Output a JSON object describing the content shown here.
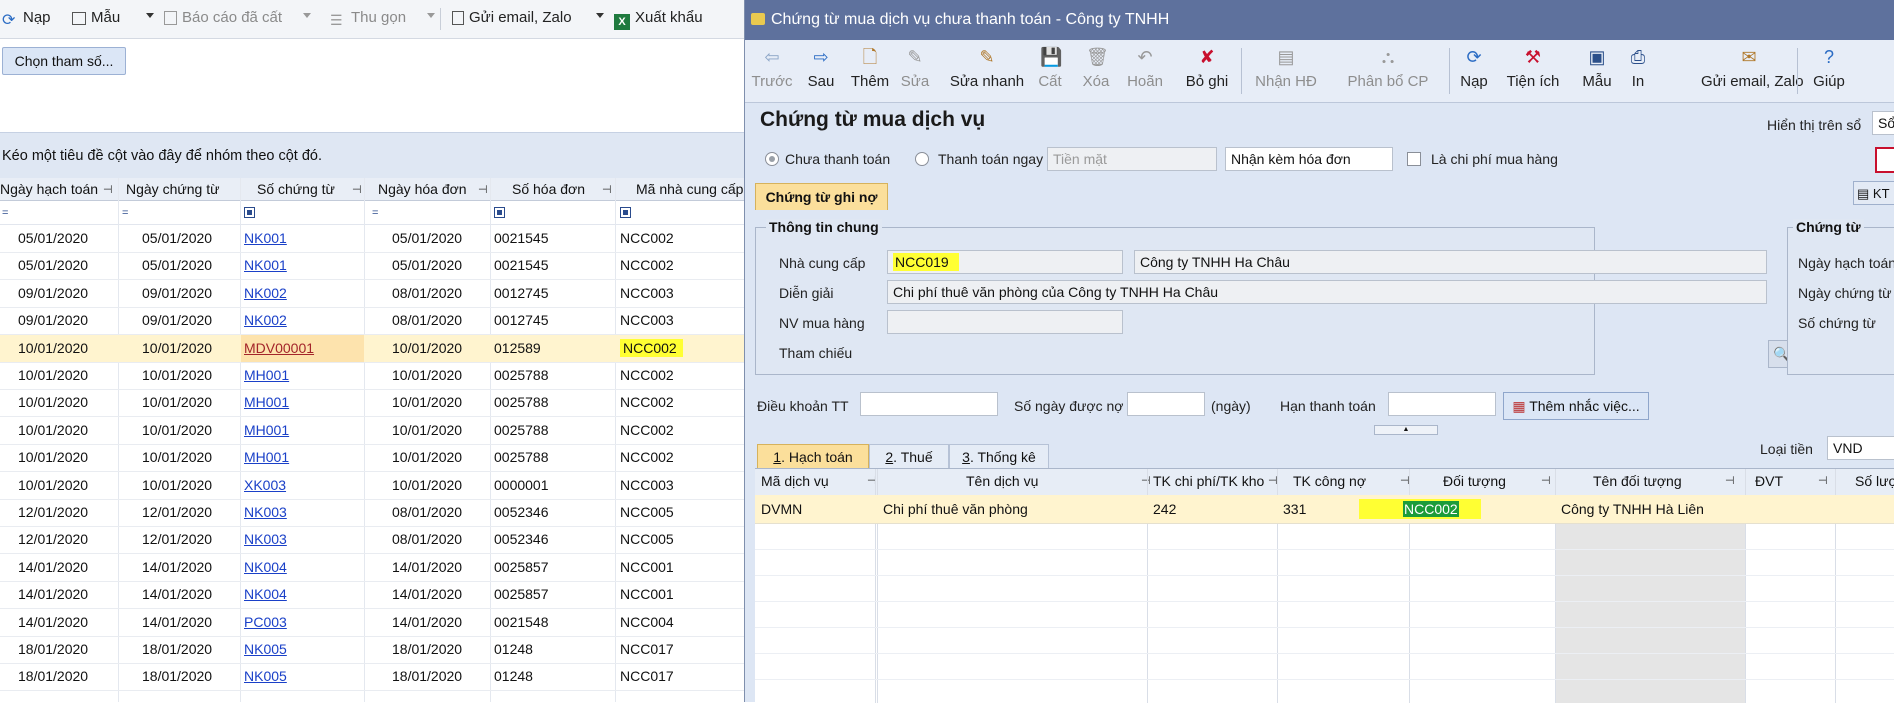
{
  "left_window": {
    "toolbar": [
      {
        "icon": "refresh-icon",
        "label": "Nạp",
        "disabled": false
      },
      {
        "icon": "template-icon",
        "label": "Mẫu",
        "disabled": false
      },
      {
        "icon": "report-icon",
        "label": "Báo cáo đã cất",
        "disabled": true
      },
      {
        "icon": "collapse-icon",
        "label": "Thu gọn",
        "disabled": true
      },
      {
        "icon": "email-icon",
        "label": "Gửi email, Zalo",
        "disabled": false
      },
      {
        "icon": "excel-icon",
        "label": "Xuất khẩu",
        "disabled": false
      }
    ],
    "choose_param_button": "Chọn tham số...",
    "group_hint": "Kéo một tiêu đề cột vào đây để nhóm theo cột đó.",
    "columns": [
      "Ngày hạch toán",
      "Ngày chứng từ",
      "Số chứng từ",
      "Ngày hóa đơn",
      "Số hóa đơn",
      "Mã nhà cung cấp"
    ],
    "rows": [
      [
        "05/01/2020",
        "05/01/2020",
        "NK001",
        "05/01/2020",
        "0021545",
        "NCC002"
      ],
      [
        "05/01/2020",
        "05/01/2020",
        "NK001",
        "05/01/2020",
        "0021545",
        "NCC002"
      ],
      [
        "09/01/2020",
        "09/01/2020",
        "NK002",
        "08/01/2020",
        "0012745",
        "NCC003"
      ],
      [
        "09/01/2020",
        "09/01/2020",
        "NK002",
        "08/01/2020",
        "0012745",
        "NCC003"
      ],
      [
        "10/01/2020",
        "10/01/2020",
        "MDV00001",
        "10/01/2020",
        "012589",
        "NCC002"
      ],
      [
        "10/01/2020",
        "10/01/2020",
        "MH001",
        "10/01/2020",
        "0025788",
        "NCC002"
      ],
      [
        "10/01/2020",
        "10/01/2020",
        "MH001",
        "10/01/2020",
        "0025788",
        "NCC002"
      ],
      [
        "10/01/2020",
        "10/01/2020",
        "MH001",
        "10/01/2020",
        "0025788",
        "NCC002"
      ],
      [
        "10/01/2020",
        "10/01/2020",
        "MH001",
        "10/01/2020",
        "0025788",
        "NCC002"
      ],
      [
        "10/01/2020",
        "10/01/2020",
        "XK003",
        "10/01/2020",
        "0000001",
        "NCC003"
      ],
      [
        "12/01/2020",
        "12/01/2020",
        "NK003",
        "08/01/2020",
        "0052346",
        "NCC005"
      ],
      [
        "12/01/2020",
        "12/01/2020",
        "NK003",
        "08/01/2020",
        "0052346",
        "NCC005"
      ],
      [
        "14/01/2020",
        "14/01/2020",
        "NK004",
        "14/01/2020",
        "0025857",
        "NCC001"
      ],
      [
        "14/01/2020",
        "14/01/2020",
        "NK004",
        "14/01/2020",
        "0025857",
        "NCC001"
      ],
      [
        "14/01/2020",
        "14/01/2020",
        "PC003",
        "14/01/2020",
        "0021548",
        "NCC004"
      ],
      [
        "18/01/2020",
        "18/01/2020",
        "NK005",
        "18/01/2020",
        "01248",
        "NCC017"
      ],
      [
        "18/01/2020",
        "18/01/2020",
        "NK005",
        "18/01/2020",
        "01248",
        "NCC017"
      ]
    ]
  },
  "dialog": {
    "title": "Chứng từ mua dịch vụ chưa thanh toán - Công ty TNHH",
    "toolbar": [
      {
        "label": "Trước",
        "glyph": "⇦",
        "disabled": true
      },
      {
        "label": "Sau",
        "glyph": "⇨",
        "disabled": false
      },
      {
        "label": "Thêm",
        "glyph": "🗋",
        "disabled": false
      },
      {
        "label": "Sửa",
        "glyph": "✎",
        "disabled": true
      },
      {
        "label": "Sửa nhanh",
        "glyph": "✎",
        "disabled": false
      },
      {
        "label": "Cất",
        "glyph": "💾",
        "disabled": true
      },
      {
        "label": "Xóa",
        "glyph": "🗑",
        "disabled": true
      },
      {
        "label": "Hoãn",
        "glyph": "↶",
        "disabled": true
      },
      {
        "label": "Bỏ ghi",
        "glyph": "✘",
        "disabled": false
      },
      {
        "label": "Nhận HĐ",
        "glyph": "▤",
        "disabled": true
      },
      {
        "label": "Phân bổ CP",
        "glyph": "⛬",
        "disabled": true
      },
      {
        "label": "Nạp",
        "glyph": "⟳",
        "disabled": false
      },
      {
        "label": "Tiện ích",
        "glyph": "⚒",
        "disabled": false
      },
      {
        "label": "Mẫu",
        "glyph": "▣",
        "disabled": false
      },
      {
        "label": "In",
        "glyph": "⎙",
        "disabled": false
      },
      {
        "label": "Gửi email, Zalo",
        "glyph": "✉",
        "disabled": false
      },
      {
        "label": "Giúp",
        "glyph": "?",
        "disabled": false
      }
    ],
    "heading": "Chứng từ mua dịch vụ",
    "display_on_book_label": "Hiển thị trên sổ",
    "display_on_book_value": "Sổ",
    "payment": {
      "unpaid": "Chưa thanh toán",
      "paid_now": "Thanh toán ngay",
      "method_placeholder": "Tiền mặt",
      "invoice_option": "Nhận kèm hóa đơn",
      "purchase_cost": "Là chi phí mua hàng"
    },
    "tab_main": "Chứng từ ghi nợ",
    "kt_button": "KT",
    "general": {
      "title": "Thông tin chung",
      "supplier_label": "Nhà cung cấp",
      "supplier_code": "NCC019",
      "supplier_name": "Công ty TNHH Ha Châu",
      "description_label": "Diễn giải",
      "description": "Chi phí thuê văn phòng của Công ty TNHH Ha Châu",
      "buyer_label": "NV mua hàng",
      "buyer": "",
      "reference_label": "Tham chiếu"
    },
    "voucher": {
      "title": "Chứng từ",
      "posting_date_label": "Ngày hạch toán",
      "voucher_date_label": "Ngày chứng từ",
      "voucher_no_label": "Số chứng từ"
    },
    "terms": {
      "terms_label": "Điều khoản TT",
      "days_label": "Số ngày được nợ",
      "days_unit": "(ngày)",
      "due_label": "Hạn thanh toán",
      "reminder_button": "Thêm nhắc việc..."
    },
    "detail_tabs": [
      {
        "num": "1",
        "label": ". Hạch toán"
      },
      {
        "num": "2",
        "label": ". Thuế"
      },
      {
        "num": "3",
        "label": ". Thống kê"
      }
    ],
    "currency_label": "Loại tiền",
    "currency": "VND",
    "detail_columns": [
      "Mã dịch vụ",
      "Tên dịch vụ",
      "TK chi phí/TK kho",
      "TK công nợ",
      "Đối tượng",
      "Tên đối tượng",
      "ĐVT",
      "Số lượ"
    ],
    "detail_row": [
      "DVMN",
      "Chi phí thuê văn phòng",
      "242",
      "331",
      "NCC002",
      "Công ty TNHH Hà Liên",
      "",
      ""
    ]
  }
}
